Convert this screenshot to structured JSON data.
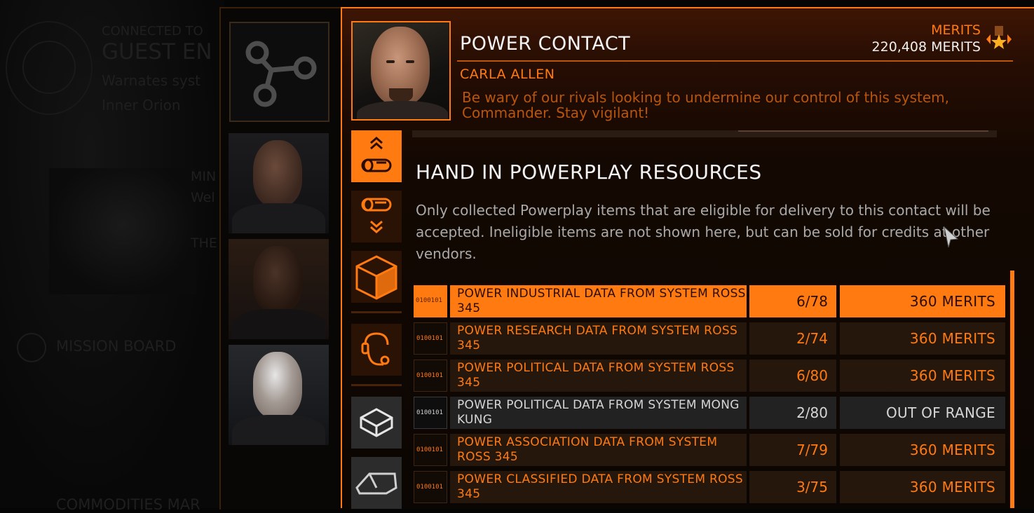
{
  "background": {
    "connected_to": "CONNECTED TO",
    "station": "GUEST EN",
    "system_line": "Warnates syst",
    "sub_line": "Inner Orion",
    "mission_side_1": "MIN",
    "mission_side_2": "Wel",
    "mission_side_3": "THE",
    "mission_board": "MISSION BOARD",
    "commodities": "COMMODITIES MAR"
  },
  "colors": {
    "accent": "#ff7a10",
    "dim_accent": "#b8560c",
    "text_light": "#f4f4f4",
    "disabled": "#d6d6d6"
  },
  "header": {
    "title": "POWER CONTACT",
    "merits_label": "MERITS",
    "merits_value": "220,408 MERITS",
    "rank_icon": "rank-star-icon"
  },
  "contact": {
    "name": "CARLA ALLEN",
    "quote": "Be wary of our rivals looking to undermine our control of this system, Commander. Stay vigilant!"
  },
  "side_tabs": [
    {
      "icon": "hand-in-cargo-icon",
      "active": true
    },
    {
      "icon": "collect-cargo-icon",
      "active": false
    },
    {
      "icon": "cargo-box-icon",
      "active": false
    },
    {
      "icon": "contact-headset-icon",
      "active": false
    },
    {
      "icon": "data-package-icon",
      "active": false
    },
    {
      "icon": "ship-module-icon",
      "active": false
    }
  ],
  "section": {
    "heading": "HAND IN POWERPLAY RESOURCES",
    "description": "Only collected Powerplay items that are eligible for delivery to this contact will be accepted. Ineligible items are not shown here, but can be sold for credits at other vendors."
  },
  "resources": [
    {
      "code": "0100101",
      "name": "POWER INDUSTRIAL DATA FROM SYSTEM ROSS 345",
      "qty": "6/78",
      "reward": "360 MERITS",
      "state": "selected"
    },
    {
      "code": "0100101",
      "name": "POWER RESEARCH DATA FROM SYSTEM ROSS 345",
      "qty": "2/74",
      "reward": "360 MERITS",
      "state": "normal"
    },
    {
      "code": "0100101",
      "name": "POWER POLITICAL DATA FROM SYSTEM ROSS 345",
      "qty": "6/80",
      "reward": "360 MERITS",
      "state": "normal"
    },
    {
      "code": "0100101",
      "name": "POWER POLITICAL DATA FROM SYSTEM MONG KUNG",
      "qty": "2/80",
      "reward": "OUT OF RANGE",
      "state": "disabled"
    },
    {
      "code": "0100101",
      "name": "POWER ASSOCIATION DATA FROM SYSTEM ROSS 345",
      "qty": "7/79",
      "reward": "360 MERITS",
      "state": "normal"
    },
    {
      "code": "0100101",
      "name": "POWER CLASSIFIED DATA FROM SYSTEM ROSS 345",
      "qty": "3/75",
      "reward": "360 MERITS",
      "state": "normal"
    }
  ]
}
